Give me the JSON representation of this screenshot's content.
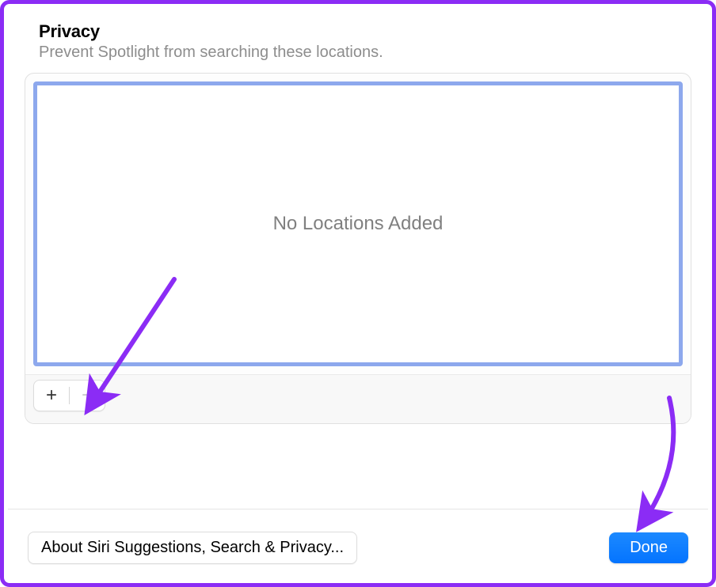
{
  "header": {
    "title": "Privacy",
    "subtitle": "Prevent Spotlight from searching these locations."
  },
  "locations": {
    "empty_message": "No Locations Added",
    "add_label": "+",
    "remove_label": "−"
  },
  "footer": {
    "about_label": "About Siri Suggestions, Search & Privacy...",
    "done_label": "Done"
  },
  "annotation": {
    "arrow_color": "#8b2cf5"
  }
}
